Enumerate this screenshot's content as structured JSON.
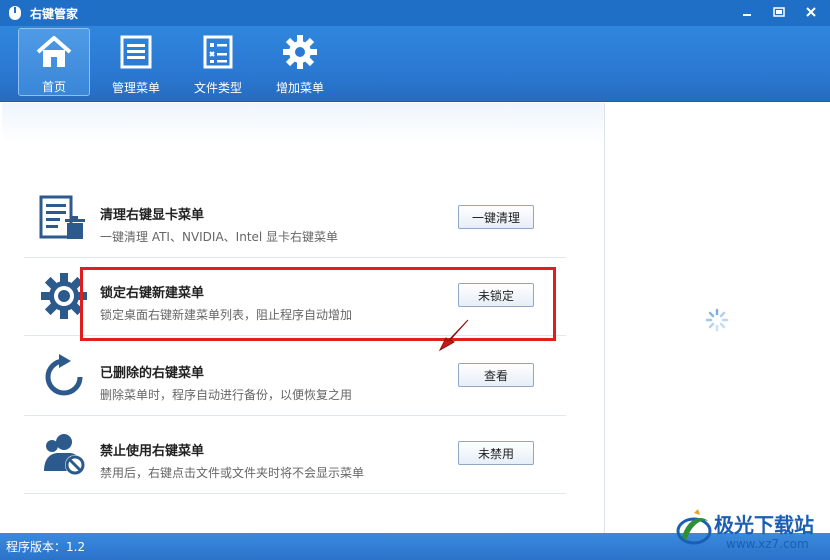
{
  "window": {
    "title": "右键管家",
    "controls": [
      "minimize",
      "restore",
      "close"
    ]
  },
  "toolbar": {
    "items": [
      {
        "label": "首页",
        "icon": "home-icon",
        "active": true
      },
      {
        "label": "管理菜单",
        "icon": "menu-list-icon",
        "active": false
      },
      {
        "label": "文件类型",
        "icon": "file-type-icon",
        "active": false
      },
      {
        "label": "增加菜单",
        "icon": "gear-icon",
        "active": false
      }
    ]
  },
  "rows": [
    {
      "title": "清理右键显卡菜单",
      "desc": "一键清理 ATI、NVIDIA、Intel 显卡右键菜单",
      "button": "一键清理",
      "icon": "clean-list-icon"
    },
    {
      "title": "锁定右键新建菜单",
      "desc": "锁定桌面右键新建菜单列表，阻止程序自动增加",
      "button": "未锁定",
      "icon": "gear-icon"
    },
    {
      "title": "已删除的右键菜单",
      "desc": "删除菜单时，程序自动进行备份，以便恢复之用",
      "button": "查看",
      "icon": "refresh-icon"
    },
    {
      "title": "禁止使用右键菜单",
      "desc": "禁用后，右键点击文件或文件夹时将不会显示菜单",
      "button": "未禁用",
      "icon": "user-block-icon"
    }
  ],
  "status": {
    "version": "程序版本：1.2"
  },
  "watermark": {
    "name": "极光下载站",
    "url": "www.xz7.com"
  },
  "colors": {
    "titlebar": "#1f6fc6",
    "toolbar": "#2b79d3",
    "highlight": "#e01e1e",
    "icon": "#2c5a8c"
  }
}
